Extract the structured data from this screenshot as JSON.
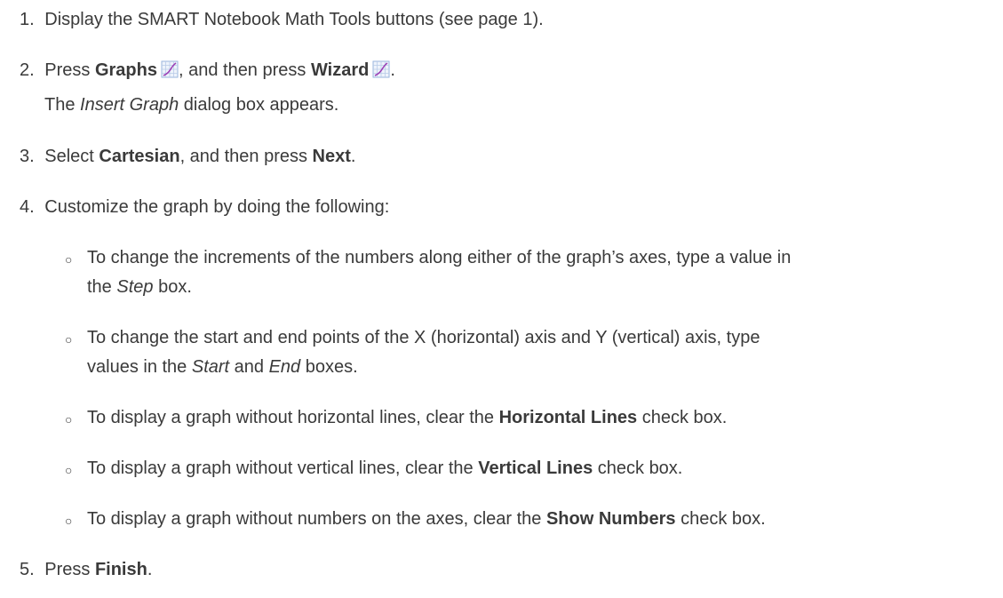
{
  "steps": {
    "s1": {
      "num": "1.",
      "text": "Display the SMART Notebook Math Tools buttons (see page 1)."
    },
    "s2": {
      "num": "2.",
      "a": "Press ",
      "b1": "Graphs",
      "c": ", and then press ",
      "b2": "Wizard",
      "d": ".",
      "note_a": "The ",
      "note_i": "Insert Graph",
      "note_b": " dialog box appears."
    },
    "s3": {
      "num": "3.",
      "a": "Select ",
      "b1": "Cartesian",
      "c": ", and then press ",
      "b2": "Next",
      "d": "."
    },
    "s4": {
      "num": "4.",
      "text": "Customize the graph by doing the following:"
    },
    "s5": {
      "num": "5.",
      "a": "Press ",
      "b": "Finish",
      "c": "."
    }
  },
  "bullets": {
    "marker": "○",
    "b1": {
      "l1": "To change the increments of the numbers along either of the graph’s axes, type a value in",
      "l2a": "the ",
      "l2i": "Step",
      "l2b": " box."
    },
    "b2": {
      "l1": "To change the start and end points of the X (horizontal) axis and Y (vertical) axis, type",
      "l2a": "values in the ",
      "l2i1": "Start",
      "l2m": " and ",
      "l2i2": "End",
      "l2b": " boxes."
    },
    "b3": {
      "a": "To display a graph without horizontal lines, clear the ",
      "b": "Horizontal Lines",
      "c": " check box."
    },
    "b4": {
      "a": "To display a graph without vertical lines, clear the ",
      "b": "Vertical Lines",
      "c": " check box."
    },
    "b5": {
      "a": "To display a graph without numbers on the axes, clear the ",
      "b": "Show Numbers",
      "c": " check box."
    }
  },
  "icons": {
    "graphs": "graph-icon",
    "wizard": "graph-wizard-icon"
  },
  "colors": {
    "text": "#3a3a3a",
    "icon_grid": "#9ab6de",
    "icon_curve": "#9b3fb5"
  }
}
